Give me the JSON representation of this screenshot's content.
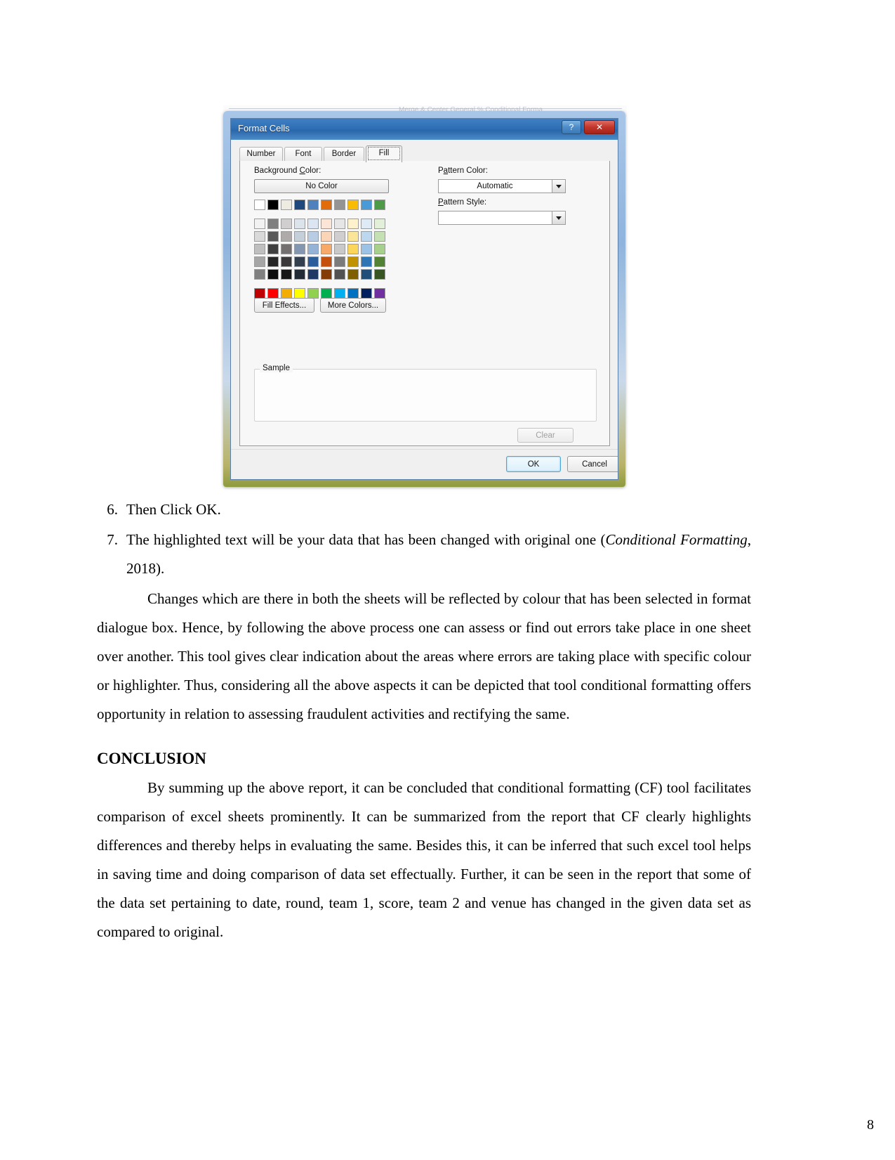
{
  "document": {
    "page_number": "8",
    "list_items": [
      {
        "num": "6.",
        "text": "Then Click OK."
      },
      {
        "num": "7.",
        "text_before": "The highlighted text will be your data that has been changed with original one (",
        "text_italic": "Conditional Formatting",
        "text_after": ", 2018)."
      }
    ],
    "paragraphs": [
      "Changes which are there in both the sheets will be reflected by colour that has been selected in format dialogue box. Hence, by following the above process one can assess or find out errors take place in one sheet over another. This tool gives clear indication about the areas where errors are taking place with specific colour or highlighter. Thus, considering all the above aspects it can be depicted that tool conditional formatting offers opportunity in relation to assessing fraudulent activities and rectifying the same."
    ],
    "conclusion_heading": "CONCLUSION",
    "conclusion_paragraph": "By summing up the above report, it can be concluded that conditional formatting (CF) tool facilitates comparison of excel sheets prominently. It can be summarized from the report that CF clearly highlights differences and thereby helps in evaluating the same. Besides this, it can be inferred that such excel tool helps in saving time and doing comparison of data set effectually. Further, it can be seen in the report that some of the data set pertaining to date, round, team 1, score, team 2 and  venue  has changed in the given data set as compared to original."
  },
  "ribbon": {
    "faded_text": "Merge & Center        General        %        Conditional Forma"
  },
  "dialog": {
    "title": "Format Cells",
    "help_button": "?",
    "close_button": "✕",
    "tabs": [
      {
        "label": "Number",
        "active": false
      },
      {
        "label": "Font",
        "active": false
      },
      {
        "label": "Border",
        "active": false
      },
      {
        "label": "Fill",
        "active": true
      }
    ],
    "background_color_label": "Background Color:",
    "background_color_label_parts": {
      "pre": "Background ",
      "accel": "C",
      "post": "olor:"
    },
    "no_color_button": "No Color",
    "pattern_color_label_parts": {
      "pre": "P",
      "accel": "a",
      "post": "ttern Color:"
    },
    "pattern_color_value": "Automatic",
    "pattern_style_label_parts": {
      "pre": "",
      "accel": "P",
      "post": "attern Style:"
    },
    "pattern_style_value": "",
    "fill_effects_button": "Fill Effects...",
    "more_colors_button": "More Colors...",
    "sample_group_label": "Sample",
    "clear_button": "Clear",
    "ok_button": "OK",
    "cancel_button": "Cancel",
    "palette": {
      "theme_row": [
        "#ffffff",
        "#000000",
        "#eeece1",
        "#1f497d",
        "#4f81bd",
        "#e36c0a",
        "#949494",
        "#f9bc02",
        "#4a9ad8",
        "#4e9b47"
      ],
      "tint_rows": [
        [
          "#f2f2f2",
          "#7f7f7f",
          "#d0cece",
          "#dde3ea",
          "#dce6f2",
          "#fbe5d6",
          "#e7e6e6",
          "#fdf2cc",
          "#deeaf6",
          "#e2efd9"
        ],
        [
          "#d9d9d9",
          "#595959",
          "#aeaaaa",
          "#c5cfda",
          "#b8cce4",
          "#fad5b8",
          "#d0cece",
          "#fbe599",
          "#bdd7ee",
          "#c5e0b3"
        ],
        [
          "#bfbfbf",
          "#3f3f3f",
          "#757070",
          "#8496b0",
          "#95b3d7",
          "#f7a96a",
          "#c9c9c9",
          "#fcd55b",
          "#9cc3e5",
          "#a8d08d"
        ],
        [
          "#a6a6a6",
          "#262626",
          "#3a3838",
          "#333f4f",
          "#2c5d9b",
          "#c5500e",
          "#7b7b7b",
          "#c09100",
          "#2e75b6",
          "#548235"
        ],
        [
          "#808080",
          "#0d0d0d",
          "#171616",
          "#222a35",
          "#1f3864",
          "#833c05",
          "#525252",
          "#7f6000",
          "#1f4e79",
          "#375623"
        ]
      ],
      "standard_row": [
        "#c00000",
        "#fe0000",
        "#f2ad00",
        "#feff00",
        "#92d050",
        "#00b050",
        "#00b0f0",
        "#0070c0",
        "#002060",
        "#7030a0"
      ]
    }
  }
}
